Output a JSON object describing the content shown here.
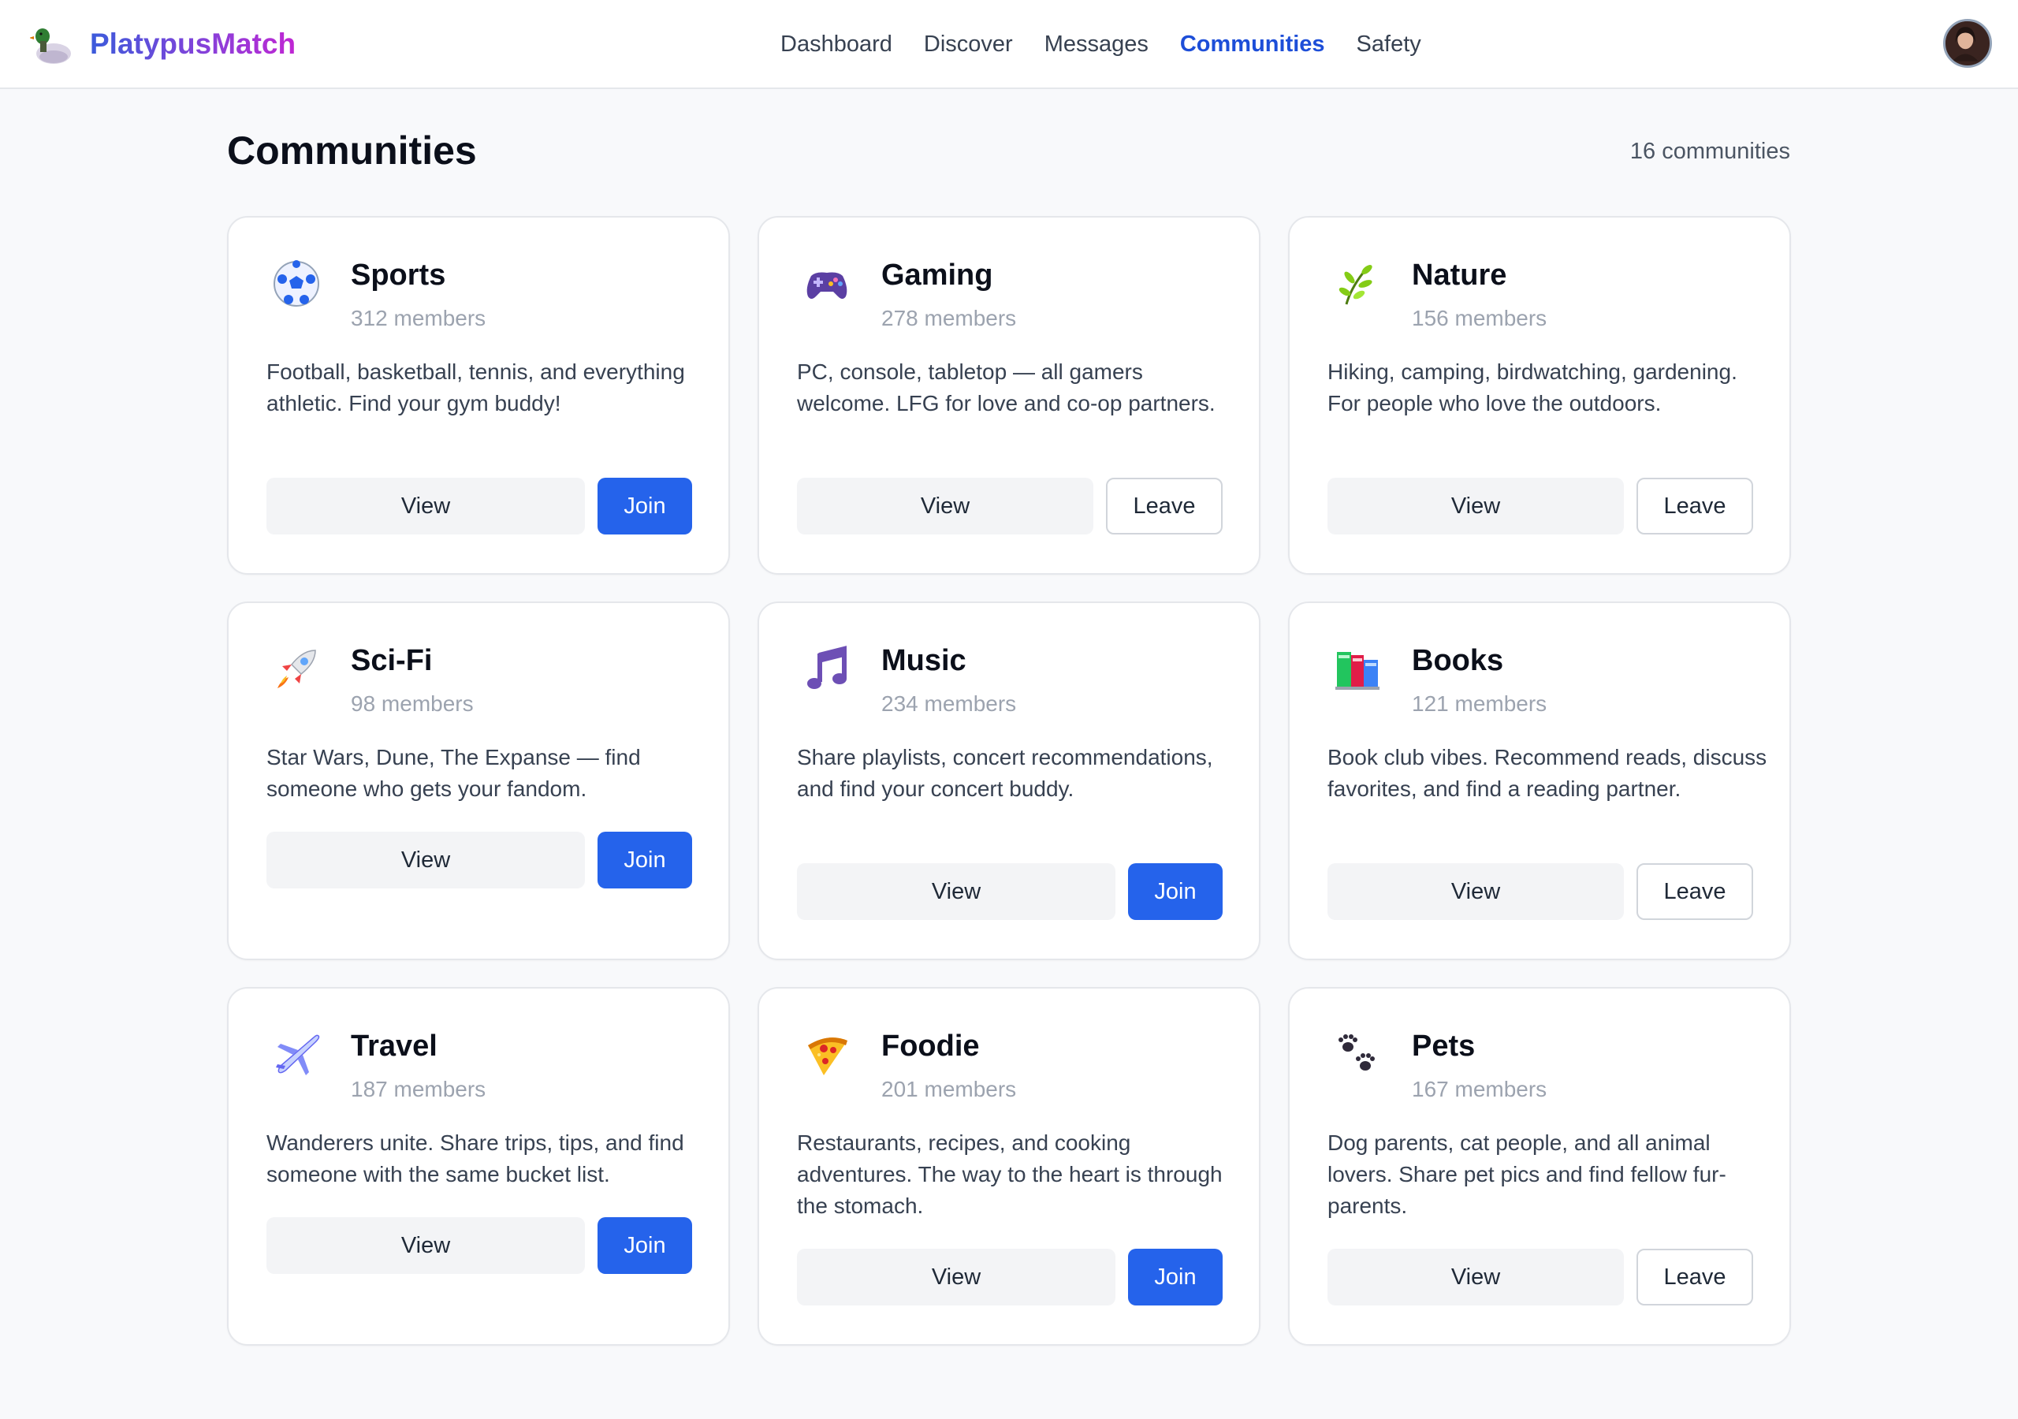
{
  "app": {
    "name": "PlatypusMatch",
    "logo_icon": "duck-logo-icon"
  },
  "nav": {
    "items": [
      {
        "label": "Dashboard",
        "active": false
      },
      {
        "label": "Discover",
        "active": false
      },
      {
        "label": "Messages",
        "active": false
      },
      {
        "label": "Communities",
        "active": true
      },
      {
        "label": "Safety",
        "active": false
      }
    ],
    "avatar_icon": "user-avatar"
  },
  "page": {
    "title": "Communities",
    "count_text": "16 communities"
  },
  "colors": {
    "accent": "#2563eb",
    "active_nav": "#1d4ed8",
    "muted_text": "#9ca3af"
  },
  "communities": [
    {
      "name": "Sports",
      "members": "312 members",
      "description": "Football, basketball, tennis, and everything athletic. Find your gym buddy!",
      "icon": "soccer-ball-icon",
      "view_label": "View",
      "action_label": "Join",
      "joined": false
    },
    {
      "name": "Gaming",
      "members": "278 members",
      "description": "PC, console, tabletop — all gamers welcome. LFG for love and co-op partners.",
      "icon": "game-controller-icon",
      "view_label": "View",
      "action_label": "Leave",
      "joined": true
    },
    {
      "name": "Nature",
      "members": "156 members",
      "description": "Hiking, camping, birdwatching, gardening. For people who love the outdoors.",
      "icon": "herb-leaf-icon",
      "view_label": "View",
      "action_label": "Leave",
      "joined": true
    },
    {
      "name": "Sci-Fi",
      "members": "98 members",
      "description": "Star Wars, Dune, The Expanse — find someone who gets your fandom.",
      "icon": "rocket-icon",
      "view_label": "View",
      "action_label": "Join",
      "joined": false
    },
    {
      "name": "Music",
      "members": "234 members",
      "description": "Share playlists, concert recommendations, and find your concert buddy.",
      "icon": "music-note-icon",
      "view_label": "View",
      "action_label": "Join",
      "joined": false
    },
    {
      "name": "Books",
      "members": "121 members",
      "description": "Book club vibes. Recommend reads, discuss favorites, and find a reading partner.",
      "icon": "books-icon",
      "view_label": "View",
      "action_label": "Leave",
      "joined": true
    },
    {
      "name": "Travel",
      "members": "187 members",
      "description": "Wanderers unite. Share trips, tips, and find someone with the same bucket list.",
      "icon": "airplane-icon",
      "view_label": "View",
      "action_label": "Join",
      "joined": false
    },
    {
      "name": "Foodie",
      "members": "201 members",
      "description": "Restaurants, recipes, and cooking adventures. The way to the heart is through the stomach.",
      "icon": "pizza-icon",
      "view_label": "View",
      "action_label": "Join",
      "joined": false
    },
    {
      "name": "Pets",
      "members": "167 members",
      "description": "Dog parents, cat people, and all animal lovers. Share pet pics and find fellow fur-parents.",
      "icon": "paw-prints-icon",
      "view_label": "View",
      "action_label": "Leave",
      "joined": true
    }
  ]
}
